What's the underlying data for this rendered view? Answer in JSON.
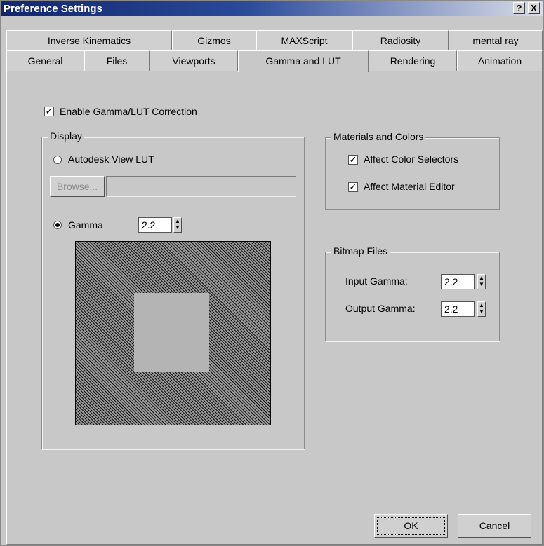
{
  "window": {
    "title": "Preference Settings",
    "help_label": "?",
    "close_label": "X"
  },
  "tabs": {
    "row1": [
      "Inverse Kinematics",
      "Gizmos",
      "MAXScript",
      "Radiosity",
      "mental ray"
    ],
    "row2": [
      "General",
      "Files",
      "Viewports",
      "Gamma and LUT",
      "Rendering",
      "Animation"
    ],
    "active": "Gamma and LUT"
  },
  "enable": {
    "label": "Enable Gamma/LUT Correction",
    "checked": true
  },
  "display": {
    "title": "Display",
    "lut_label": "Autodesk View LUT",
    "browse_label": "Browse...",
    "gamma_label": "Gamma",
    "gamma_value": "2.2",
    "selected": "gamma"
  },
  "materials": {
    "title": "Materials and Colors",
    "color_selectors_label": "Affect Color Selectors",
    "material_editor_label": "Affect Material Editor"
  },
  "bitmap": {
    "title": "Bitmap Files",
    "input_label": "Input Gamma:",
    "input_value": "2.2",
    "output_label": "Output Gamma:",
    "output_value": "2.2"
  },
  "footer": {
    "ok_label": "OK",
    "cancel_label": "Cancel"
  },
  "icons": {
    "check": "✓",
    "spin_up": "▲",
    "spin_down": "▼"
  }
}
